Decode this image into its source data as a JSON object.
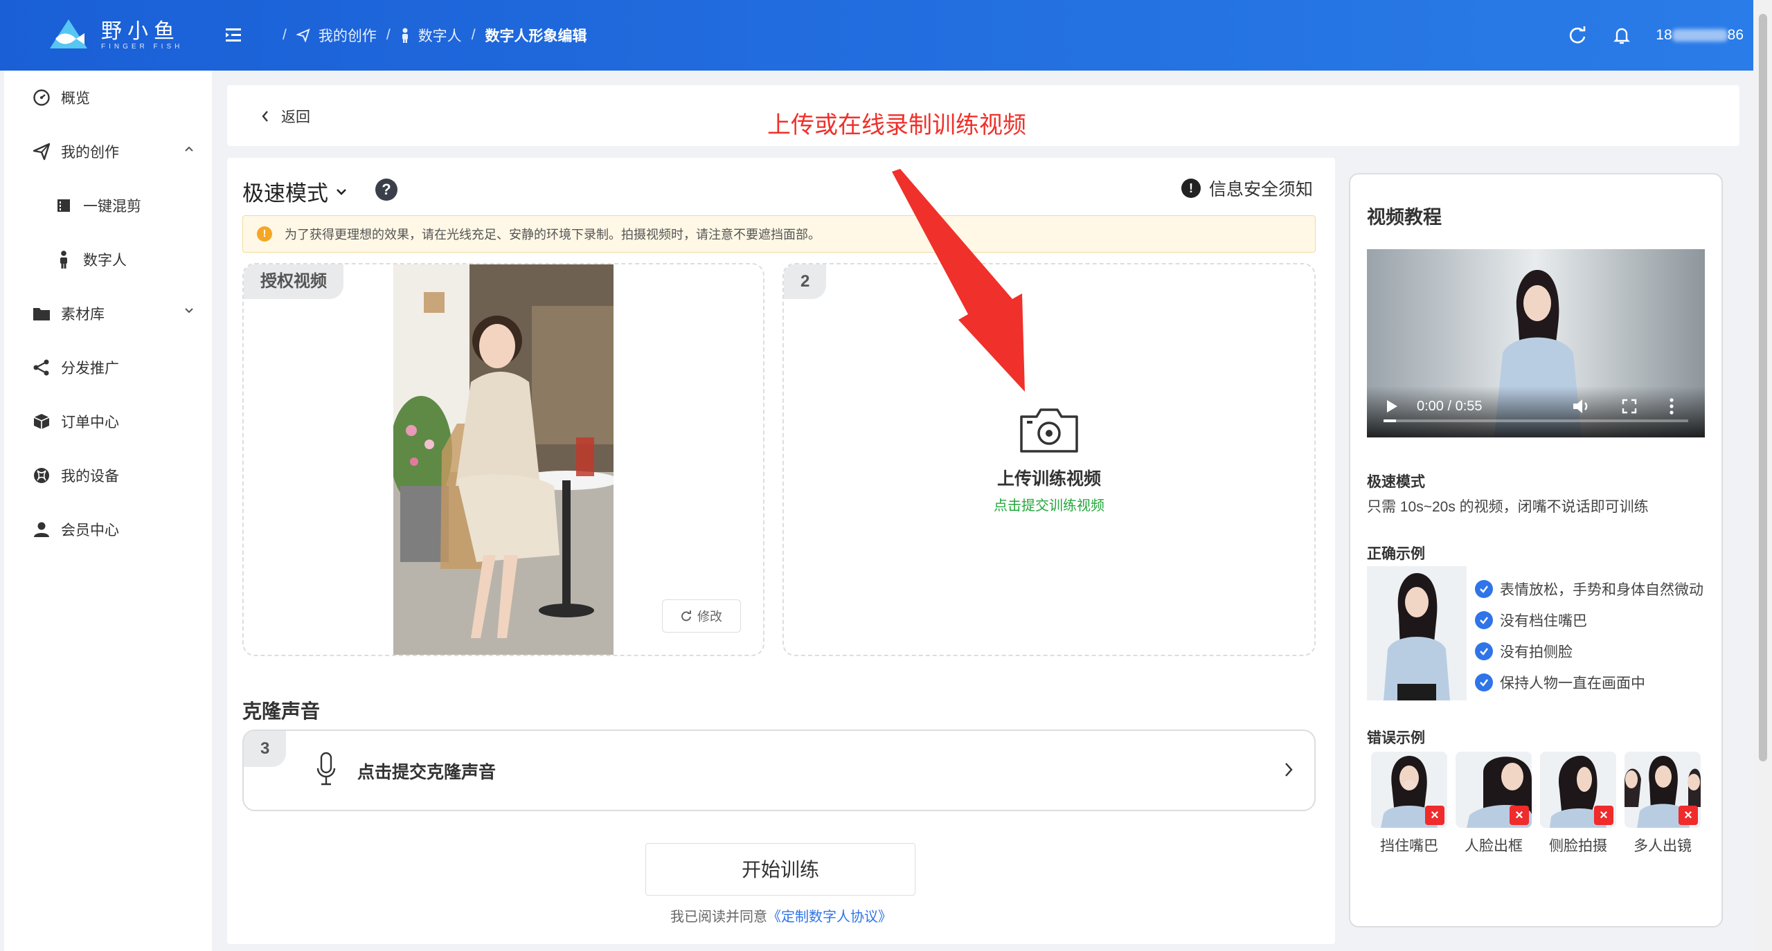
{
  "app": {
    "logo_cn": "野小鱼",
    "logo_en": "FINGER FISH",
    "user_phone_prefix": "18",
    "user_phone_suffix": "86"
  },
  "breadcrumb": {
    "items": [
      "我的创作",
      "数字人",
      "数字人形象编辑"
    ]
  },
  "sidebar": {
    "items": [
      {
        "label": "概览"
      },
      {
        "label": "我的创作"
      },
      {
        "label": "一键混剪"
      },
      {
        "label": "数字人"
      },
      {
        "label": "素材库"
      },
      {
        "label": "分发推广"
      },
      {
        "label": "订单中心"
      },
      {
        "label": "我的设备"
      },
      {
        "label": "会员中心"
      }
    ]
  },
  "header": {
    "back_label": "返回",
    "annotation": "上传或在线录制训练视频"
  },
  "main": {
    "mode_label": "极速模式",
    "help_glyph": "?",
    "security_glyph": "!",
    "security_label": "信息安全须知",
    "notice": "为了获得更理想的效果，请在光线充足、安静的环境下录制。拍摄视频时，请注意不要遮挡面部。",
    "auth_card": {
      "tag": "授权视频",
      "edit_label": "修改"
    },
    "upload_card": {
      "tag": "2",
      "title": "上传训练视频",
      "subtitle": "点击提交训练视频"
    },
    "voice": {
      "section_title": "克隆声音",
      "tag": "3",
      "label": "点击提交克隆声音"
    },
    "start_button": "开始训练",
    "agree_text": "我已阅读并同意",
    "agree_link": "《定制数字人协议》"
  },
  "tutorial": {
    "title": "视频教程",
    "video_time": "0:00 / 0:55",
    "video_progress": 0.04,
    "fast_mode_title": "极速模式",
    "fast_mode_desc": "只需 10s~20s 的视频，闭嘴不说话即可训练",
    "good_title": "正确示例",
    "good_items": [
      "表情放松，手势和身体自然微动",
      "没有档住嘴巴",
      "没有拍侧脸",
      "保持人物一直在画面中"
    ],
    "bad_title": "错误示例",
    "bad_items": [
      "挡住嘴巴",
      "人脸出框",
      "侧脸拍摄",
      "多人出镜"
    ]
  },
  "colors": {
    "topbar": "#1a5fd6",
    "accent": "#2f74e8",
    "annotation": "#f0302a",
    "success": "#22a83a",
    "warning": "#f5a623"
  }
}
